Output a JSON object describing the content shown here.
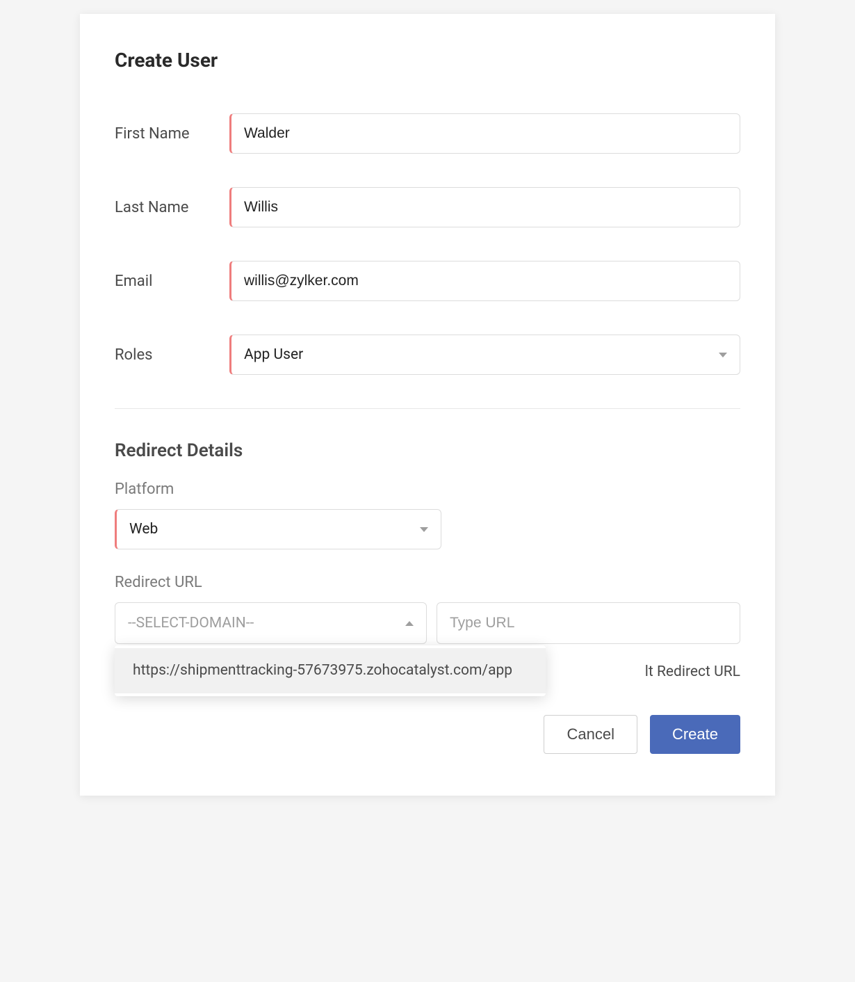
{
  "title": "Create User",
  "form": {
    "first_name": {
      "label": "First Name",
      "value": "Walder"
    },
    "last_name": {
      "label": "Last Name",
      "value": "Willis"
    },
    "email": {
      "label": "Email",
      "value": "willis@zylker.com"
    },
    "roles": {
      "label": "Roles",
      "value": "App User"
    }
  },
  "redirect": {
    "section_title": "Redirect Details",
    "platform_label": "Platform",
    "platform_value": "Web",
    "redirect_url_label": "Redirect URL",
    "domain_placeholder": "--SELECT-DOMAIN--",
    "url_placeholder": "Type URL",
    "domain_options": [
      "https://shipmenttracking-57673975.zohocatalyst.com/app"
    ],
    "default_link_suffix": "lt Redirect URL"
  },
  "buttons": {
    "cancel": "Cancel",
    "create": "Create"
  }
}
